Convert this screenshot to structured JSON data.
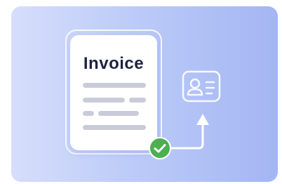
{
  "document": {
    "title": "Invoice"
  },
  "icons": {
    "status": "check-circle-icon",
    "target": "id-card-icon",
    "connector": "arrow-up-icon"
  },
  "colors": {
    "check_green": "#4caf50",
    "background_start": "#d6defb",
    "background_end": "#a4b6f3",
    "text_lines": "#c9ccd8",
    "title_text": "#1f2340"
  }
}
